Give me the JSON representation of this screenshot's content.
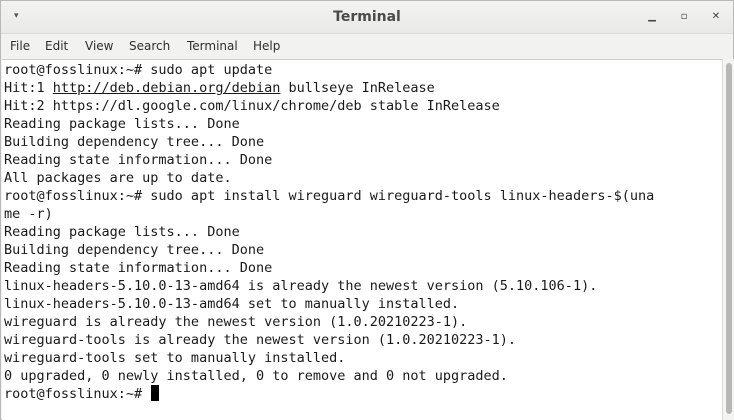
{
  "window": {
    "title": "Terminal",
    "menu_icon": "▾",
    "controls": {
      "minimize": "▁",
      "maximize": "▫",
      "close": "✕"
    }
  },
  "menu": [
    "File",
    "Edit",
    "View",
    "Search",
    "Terminal",
    "Help"
  ],
  "terminal": {
    "lines": [
      {
        "text": "root@fosslinux:~# sudo apt update"
      },
      {
        "prefix": "Hit:1 ",
        "link": "http://deb.debian.org/debian",
        "suffix": " bullseye InRelease"
      },
      {
        "text": "Hit:2 https://dl.google.com/linux/chrome/deb stable InRelease"
      },
      {
        "text": "Reading package lists... Done"
      },
      {
        "text": "Building dependency tree... Done"
      },
      {
        "text": "Reading state information... Done"
      },
      {
        "text": "All packages are up to date."
      },
      {
        "text": "root@fosslinux:~# sudo apt install wireguard wireguard-tools linux-headers-$(una"
      },
      {
        "text": "me -r)"
      },
      {
        "text": "Reading package lists... Done"
      },
      {
        "text": "Building dependency tree... Done"
      },
      {
        "text": "Reading state information... Done"
      },
      {
        "text": "linux-headers-5.10.0-13-amd64 is already the newest version (5.10.106-1)."
      },
      {
        "text": "linux-headers-5.10.0-13-amd64 set to manually installed."
      },
      {
        "text": "wireguard is already the newest version (1.0.20210223-1)."
      },
      {
        "text": "wireguard-tools is already the newest version (1.0.20210223-1)."
      },
      {
        "text": "wireguard-tools set to manually installed."
      },
      {
        "text": "0 upgraded, 0 newly installed, 0 to remove and 0 not upgraded."
      }
    ],
    "prompt": "root@fosslinux:~# "
  }
}
